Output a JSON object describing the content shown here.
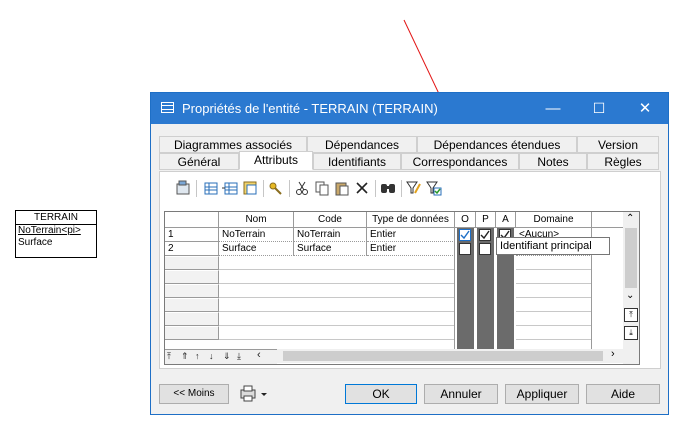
{
  "entity": {
    "name": "TERRAIN",
    "attributes": [
      {
        "text": "NoTerrain<pi>",
        "identifier": true
      },
      {
        "text": "Surface",
        "identifier": false
      }
    ]
  },
  "window": {
    "title": "Propriétés de l'entité - TERRAIN (TERRAIN)",
    "minimize": "—",
    "maximize": "☐",
    "close": "✕"
  },
  "tabs_row1": [
    "Diagrammes associés",
    "Dépendances",
    "Dépendances étendues",
    "Version"
  ],
  "tabs_row2": [
    "Général",
    "Attributs",
    "Identifiants",
    "Correspondances",
    "Notes",
    "Règles"
  ],
  "active_tab": "Attributs",
  "toolbar_icons": [
    "properties-icon",
    "add-row-icon",
    "insert-row-icon",
    "add-attributes-icon",
    "key-icon",
    "cut-icon",
    "copy-icon",
    "paste-icon",
    "delete-icon",
    "find-icon",
    "filter-icon",
    "customize-columns-icon"
  ],
  "grid": {
    "columns": [
      "Nom",
      "Code",
      "Type de données",
      "O",
      "P",
      "A",
      "Domaine"
    ],
    "rows": [
      {
        "num": "1",
        "nom": "NoTerrain",
        "code": "NoTerrain",
        "type": "Entier",
        "o": true,
        "p": true,
        "a": true,
        "domaine": "<Aucun>"
      },
      {
        "num": "2",
        "nom": "Surface",
        "code": "Surface",
        "type": "Entier",
        "o": false,
        "p": false,
        "a": false,
        "domaine": ""
      }
    ]
  },
  "tooltip": "Identifiant principal",
  "buttons": {
    "less": "<< Moins",
    "ok": "OK",
    "cancel": "Annuler",
    "apply": "Appliquer",
    "help": "Aide"
  }
}
